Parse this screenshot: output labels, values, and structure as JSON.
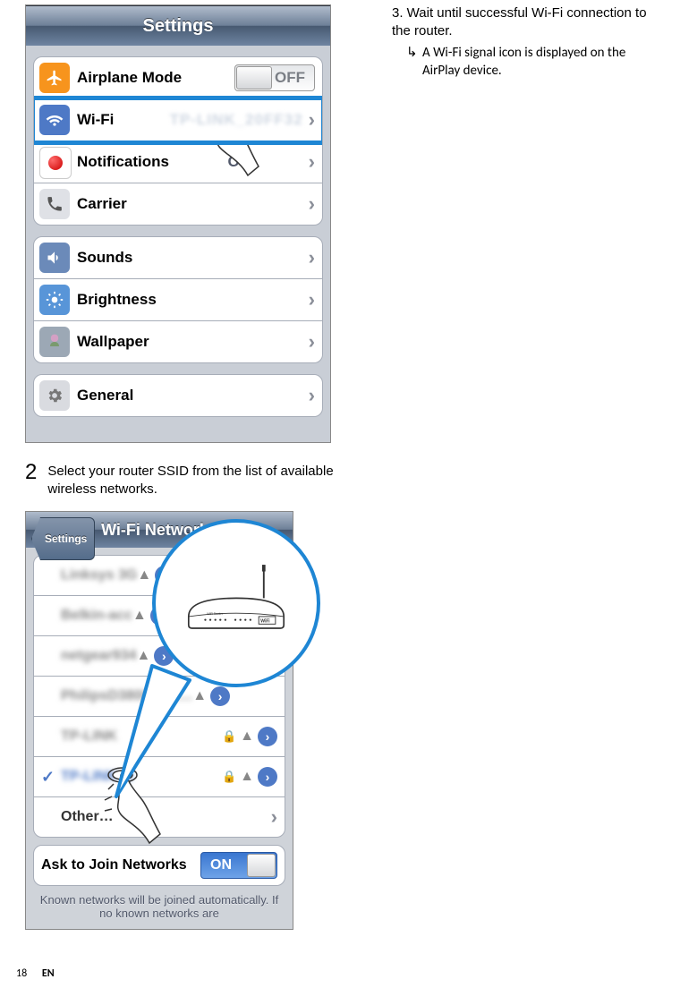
{
  "settings": {
    "title": "Settings",
    "rows": {
      "airplane": {
        "label": "Airplane Mode",
        "toggle": "OFF"
      },
      "wifi": {
        "label": "Wi-Fi",
        "value": "TP-LINK_20FF32"
      },
      "notifications": {
        "label": "Notifications",
        "value": "Off"
      },
      "carrier": {
        "label": "Carrier"
      },
      "sounds": {
        "label": "Sounds"
      },
      "brightness": {
        "label": "Brightness"
      },
      "wallpaper": {
        "label": "Wallpaper"
      },
      "general": {
        "label": "General"
      }
    }
  },
  "steps": {
    "two": {
      "num": "2",
      "text": "Select your router SSID from the list of available wireless networks."
    },
    "three": {
      "text": "3. Wait until successful Wi-Fi connection to the router.",
      "sub": "A Wi-Fi signal icon is displayed on the AirPlay device."
    }
  },
  "wifi_screen": {
    "back": "Settings",
    "title": "Wi-Fi Networks",
    "networks": [
      "Linksys 3G",
      "Belkin-acc",
      "netgear934",
      "PhilipsD3800W-B…",
      "TP-LINK",
      "TP-LINK_2"
    ],
    "other": "Other…",
    "ask_label": "Ask to Join Networks",
    "ask_toggle": "ON",
    "known_text": "Known networks will be joined automatically. If no known networks are"
  },
  "footer": {
    "page": "18",
    "lang": "EN"
  }
}
